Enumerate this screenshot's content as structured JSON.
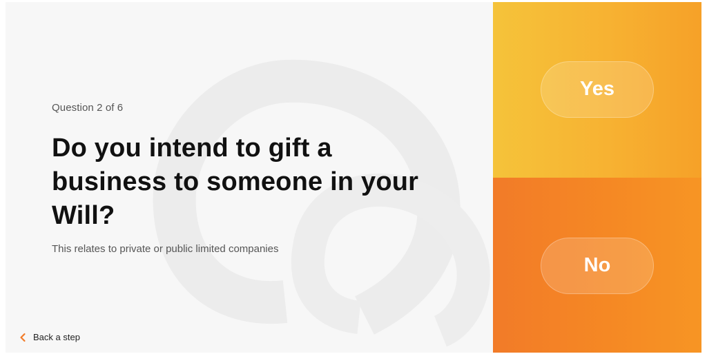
{
  "question": {
    "counter": "Question 2 of 6",
    "title": "Do you intend to gift a business to someone in your Will?",
    "help": "This relates to private or public limited companies"
  },
  "navigation": {
    "back_label": "Back a step",
    "back_icon": "chevron-left-icon"
  },
  "answers": {
    "yes_label": "Yes",
    "no_label": "No"
  },
  "colors": {
    "page_background": "#f7f7f7",
    "text_primary": "#111111",
    "text_secondary": "#555555",
    "accent_orange": "#f27b28",
    "yes_yellow": "#f5c33a",
    "no_orange": "#f58824"
  }
}
